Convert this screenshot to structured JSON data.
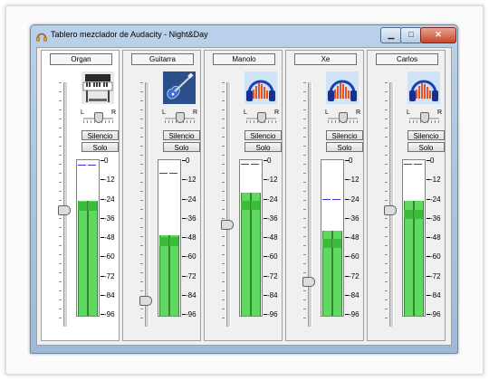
{
  "window": {
    "title": "Tablero mezclador de Audacity - Night&Day",
    "minimize_glyph": "▁",
    "maximize_glyph": "□",
    "close_glyph": "✕"
  },
  "meter_scale": [
    "0",
    "-12",
    "-24",
    "-36",
    "-48",
    "-60",
    "-72",
    "-84",
    "-96"
  ],
  "tracks": [
    {
      "name": "Organ",
      "icon": "organ-keyboard-icon",
      "pan_left": "L",
      "pan_right": "R",
      "pan_value": 0,
      "gain_level": 0.48,
      "mute_label": "Silencio",
      "solo_label": "Solo",
      "meter_level_db": -24,
      "rms_level_db": -25,
      "peak_db": -3,
      "selected": true
    },
    {
      "name": "Guitarra",
      "icon": "electric-guitar-icon",
      "pan_left": "L",
      "pan_right": "R",
      "pan_value": 0,
      "gain_level": 0.1,
      "mute_label": "Silencio",
      "solo_label": "Solo",
      "meter_level_db": -46,
      "rms_level_db": -47,
      "peak_db": -8,
      "selected": false
    },
    {
      "name": "Manolo",
      "icon": "headphones-icon",
      "pan_left": "L",
      "pan_right": "R",
      "pan_value": 0,
      "gain_level": 0.42,
      "mute_label": "Silencio",
      "solo_label": "Solo",
      "meter_level_db": -19,
      "rms_level_db": -24,
      "peak_db": -2,
      "selected": false
    },
    {
      "name": "Xe",
      "icon": "headphones-icon",
      "pan_left": "L",
      "pan_right": "R",
      "pan_value": 0,
      "gain_level": 0.18,
      "mute_label": "Silencio",
      "solo_label": "Solo",
      "meter_level_db": -43,
      "rms_level_db": -48,
      "peak_db": -24,
      "selected": false
    },
    {
      "name": "Carlos",
      "icon": "headphones-icon",
      "pan_left": "L",
      "pan_right": "R",
      "pan_value": 0,
      "gain_level": 0.48,
      "mute_label": "Silencio",
      "solo_label": "Solo",
      "meter_level_db": -24,
      "rms_level_db": -30,
      "peak_db": -2,
      "selected": false
    }
  ],
  "colors": {
    "meter_fill": "#61d861",
    "meter_rms": "#3bbd3b",
    "peak_line": "#3a3ae0",
    "titlebar": "#b9d1ea"
  }
}
